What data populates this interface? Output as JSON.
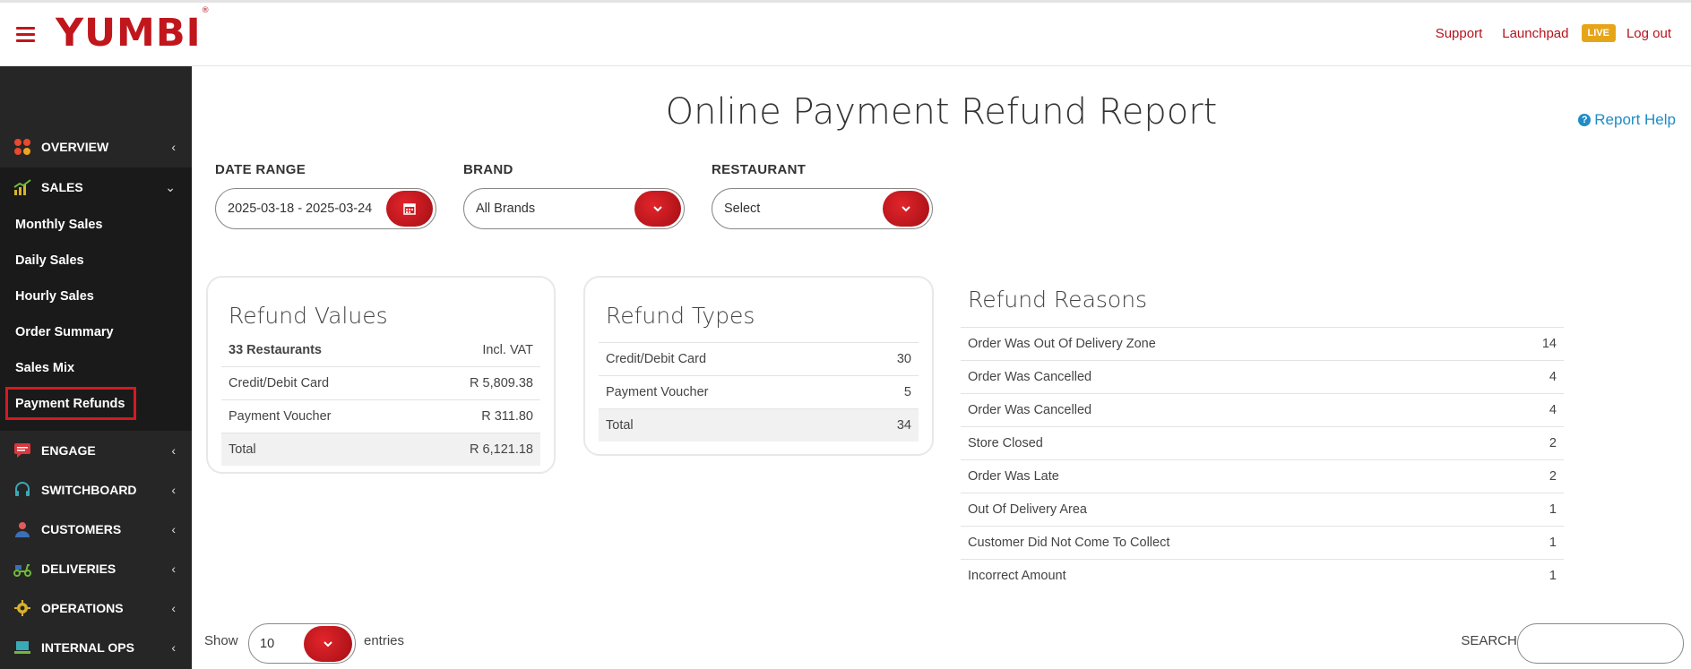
{
  "header": {
    "logo": "YUMBI",
    "logo_mark": "®",
    "links": {
      "support": "Support",
      "launchpad": "Launchpad",
      "live": "LIVE",
      "logout": "Log out"
    }
  },
  "sidebar": {
    "items": [
      {
        "label": "OVERVIEW",
        "icon": "overview-icon"
      },
      {
        "label": "SALES",
        "icon": "chart-icon"
      },
      {
        "label": "ENGAGE",
        "icon": "chat-icon"
      },
      {
        "label": "SWITCHBOARD",
        "icon": "headset-icon"
      },
      {
        "label": "CUSTOMERS",
        "icon": "user-icon"
      },
      {
        "label": "DELIVERIES",
        "icon": "scooter-icon"
      },
      {
        "label": "OPERATIONS",
        "icon": "gear-icon"
      },
      {
        "label": "INTERNAL OPS",
        "icon": "laptop-icon"
      }
    ],
    "sales_sub": [
      "Monthly Sales",
      "Daily Sales",
      "Hourly Sales",
      "Order Summary",
      "Sales Mix",
      "Payment Refunds"
    ],
    "active": "Payment Refunds"
  },
  "page": {
    "title": "Online Payment Refund Report",
    "help": "Report Help"
  },
  "filters": {
    "date_range": {
      "label": "DATE RANGE",
      "value": "2025-03-18 - 2025-03-24"
    },
    "brand": {
      "label": "BRAND",
      "value": "All Brands"
    },
    "restaurant": {
      "label": "RESTAURANT",
      "value": "Select"
    }
  },
  "refund_values": {
    "title": "Refund Values",
    "head": {
      "label": "33 Restaurants",
      "value": "Incl. VAT"
    },
    "rows": [
      {
        "label": "Credit/Debit Card",
        "value": "R 5,809.38"
      },
      {
        "label": "Payment Voucher",
        "value": "R 311.80"
      }
    ],
    "total": {
      "label": "Total",
      "value": "R 6,121.18"
    }
  },
  "refund_types": {
    "title": "Refund Types",
    "rows": [
      {
        "label": "Credit/Debit Card",
        "value": "30"
      },
      {
        "label": "Payment Voucher",
        "value": "5"
      }
    ],
    "total": {
      "label": "Total",
      "value": "34"
    }
  },
  "refund_reasons": {
    "title": "Refund Reasons",
    "rows": [
      {
        "label": "Order Was Out Of Delivery Zone",
        "value": "14"
      },
      {
        "label": "Order Was Cancelled",
        "value": "4"
      },
      {
        "label": "Order Was Cancelled",
        "value": "4"
      },
      {
        "label": "Store Closed",
        "value": "2"
      },
      {
        "label": "Order Was Late",
        "value": "2"
      },
      {
        "label": "Out Of Delivery Area",
        "value": "1"
      },
      {
        "label": "Customer Did Not Come To Collect",
        "value": "1"
      },
      {
        "label": "Incorrect Amount",
        "value": "1"
      }
    ]
  },
  "table_controls": {
    "show": "Show",
    "entries_value": "10",
    "entries": "entries",
    "search": "SEARCH:"
  },
  "colors": {
    "brand": "#c0161c",
    "live": "#e6a519",
    "help": "#1f8cc7",
    "sidebar": "#262626"
  }
}
